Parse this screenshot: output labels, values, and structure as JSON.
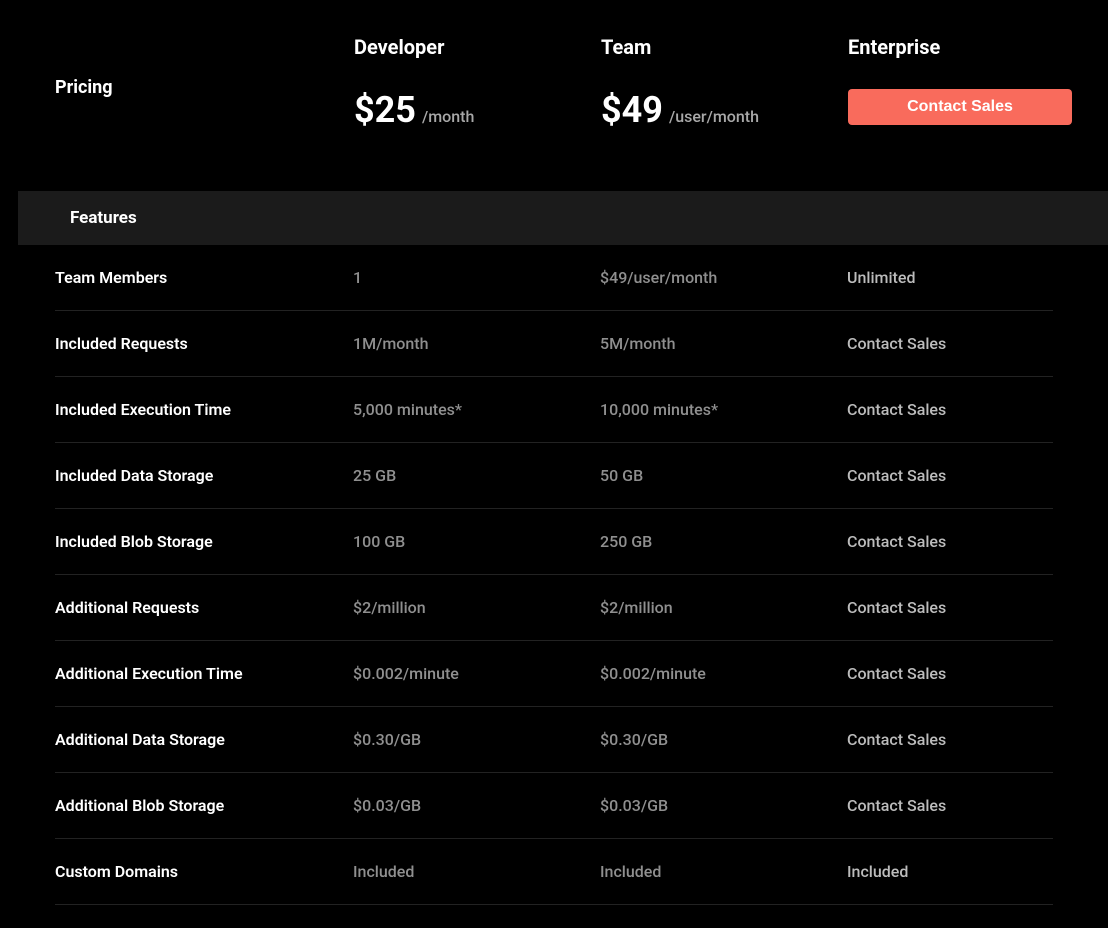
{
  "header": {
    "label": "Pricing",
    "plans": [
      {
        "name": "Developer",
        "price": "$25",
        "suffix": "/month"
      },
      {
        "name": "Team",
        "price": "$49",
        "suffix": "/user/month"
      },
      {
        "name": "Enterprise",
        "cta": "Contact Sales"
      }
    ]
  },
  "section_header": "Features",
  "features": [
    {
      "label": "Team Members",
      "v": [
        "1",
        "$49/user/month",
        "Unlimited"
      ]
    },
    {
      "label": "Included Requests",
      "v": [
        "1M/month",
        "5M/month",
        "Contact Sales"
      ]
    },
    {
      "label": "Included Execution Time",
      "v": [
        "5,000 minutes*",
        "10,000 minutes*",
        "Contact Sales"
      ]
    },
    {
      "label": "Included Data Storage",
      "v": [
        "25 GB",
        "50 GB",
        "Contact Sales"
      ]
    },
    {
      "label": "Included Blob Storage",
      "v": [
        "100 GB",
        "250 GB",
        "Contact Sales"
      ]
    },
    {
      "label": "Additional Requests",
      "v": [
        "$2/million",
        "$2/million",
        "Contact Sales"
      ]
    },
    {
      "label": "Additional Execution Time",
      "v": [
        "$0.002/minute",
        "$0.002/minute",
        "Contact Sales"
      ]
    },
    {
      "label": "Additional Data Storage",
      "v": [
        "$0.30/GB",
        "$0.30/GB",
        "Contact Sales"
      ]
    },
    {
      "label": "Additional Blob Storage",
      "v": [
        "$0.03/GB",
        "$0.03/GB",
        "Contact Sales"
      ]
    },
    {
      "label": "Custom Domains",
      "v": [
        "Included",
        "Included",
        "Included"
      ]
    }
  ]
}
